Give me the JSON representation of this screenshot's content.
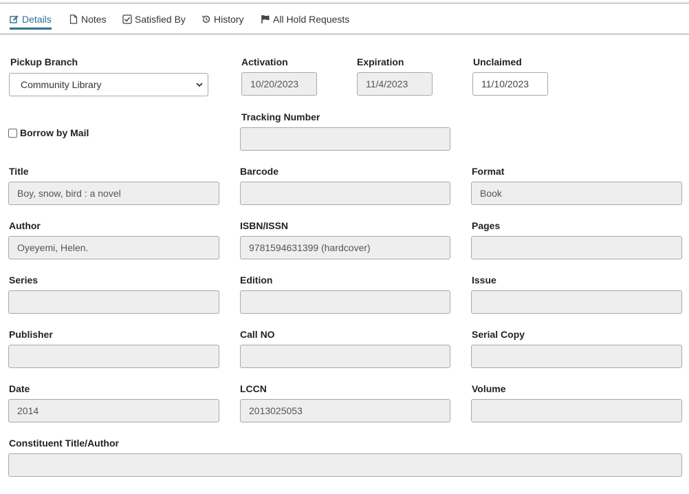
{
  "tabs": [
    {
      "label": "Details",
      "icon": "edit-icon",
      "active": true
    },
    {
      "label": "Notes",
      "icon": "file-icon"
    },
    {
      "label": "Satisfied By",
      "icon": "check-square-icon"
    },
    {
      "label": "History",
      "icon": "history-icon"
    },
    {
      "label": "All Hold Requests",
      "icon": "flag-icon"
    }
  ],
  "pickup_branch": {
    "label": "Pickup Branch",
    "value": "Community Library"
  },
  "activation": {
    "label": "Activation",
    "value": "10/20/2023"
  },
  "expiration": {
    "label": "Expiration",
    "value": "11/4/2023"
  },
  "unclaimed": {
    "label": "Unclaimed",
    "value": "11/10/2023"
  },
  "borrow_by_mail": {
    "label": "Borrow by Mail",
    "checked": false
  },
  "tracking_number": {
    "label": "Tracking Number",
    "value": ""
  },
  "title": {
    "label": "Title",
    "value": "Boy, snow, bird : a novel"
  },
  "barcode": {
    "label": "Barcode",
    "value": ""
  },
  "format": {
    "label": "Format",
    "value": "Book"
  },
  "author": {
    "label": "Author",
    "value": "Oyeyemi, Helen."
  },
  "isbn": {
    "label": "ISBN/ISSN",
    "value": "9781594631399 (hardcover)"
  },
  "pages": {
    "label": "Pages",
    "value": ""
  },
  "series": {
    "label": "Series",
    "value": ""
  },
  "edition": {
    "label": "Edition",
    "value": ""
  },
  "issue": {
    "label": "Issue",
    "value": ""
  },
  "publisher": {
    "label": "Publisher",
    "value": ""
  },
  "call_no": {
    "label": "Call NO",
    "value": ""
  },
  "serial_copy": {
    "label": "Serial Copy",
    "value": ""
  },
  "date": {
    "label": "Date",
    "value": "2014"
  },
  "lccn": {
    "label": "LCCN",
    "value": "2013025053"
  },
  "volume": {
    "label": "Volume",
    "value": ""
  },
  "constituent": {
    "label": "Constituent Title/Author",
    "value": ""
  },
  "colors": {
    "accent": "#2f6f8f",
    "readonly_bg": "#eeeeee",
    "border": "#a8a8a8"
  }
}
